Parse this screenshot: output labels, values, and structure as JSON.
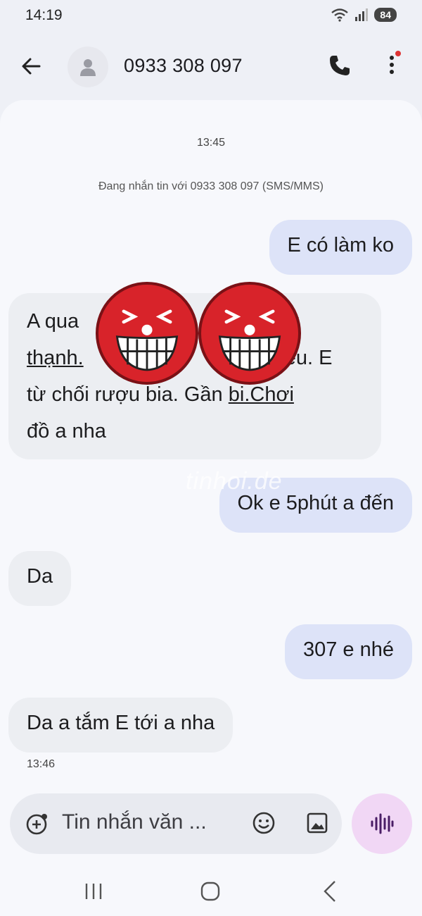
{
  "status_bar": {
    "time": "14:19",
    "battery": "84",
    "icons": [
      "wifi-icon",
      "signal-icon",
      "battery-icon"
    ]
  },
  "header": {
    "contact": "0933 308 097",
    "icons": [
      "back-arrow-icon",
      "avatar-person-icon",
      "phone-icon",
      "more-vert-icon"
    ]
  },
  "conversation": {
    "timestamp_top": "13:45",
    "sms_info": "Đang nhắn tin với 0933 308 097 (SMS/MMS)",
    "messages": [
      {
        "direction": "outgoing",
        "text": "E có làm ko"
      },
      {
        "direction": "incoming",
        "visible_fragments": [
          "A qua",
          "y",
          "thạnh.",
          "ều. E",
          "từ chối rượu bia. Gần",
          "bi.Chơi",
          "đồ a nha"
        ]
      },
      {
        "direction": "outgoing",
        "text": "Ok e 5phút a đến"
      },
      {
        "direction": "incoming",
        "text": "Da"
      },
      {
        "direction": "outgoing",
        "text": "307 e nhé"
      },
      {
        "direction": "incoming",
        "text": "Da a tắm E tới a nha"
      }
    ],
    "timestamp_bottom": "13:46",
    "watermark": "tinhoi.de"
  },
  "compose": {
    "placeholder": "Tin nhắn văn ...",
    "icons": [
      "add-attachment-icon",
      "emoji-icon",
      "gallery-icon",
      "voice-wave-icon"
    ]
  },
  "nav": {
    "icons": [
      "recents-icon",
      "home-icon",
      "back-icon"
    ]
  },
  "colors": {
    "outgoing_bubble": "#dde3f8",
    "incoming_bubble": "#eceef2",
    "sticker_red": "#d8232a",
    "voice_button": "#f1d7f5"
  }
}
